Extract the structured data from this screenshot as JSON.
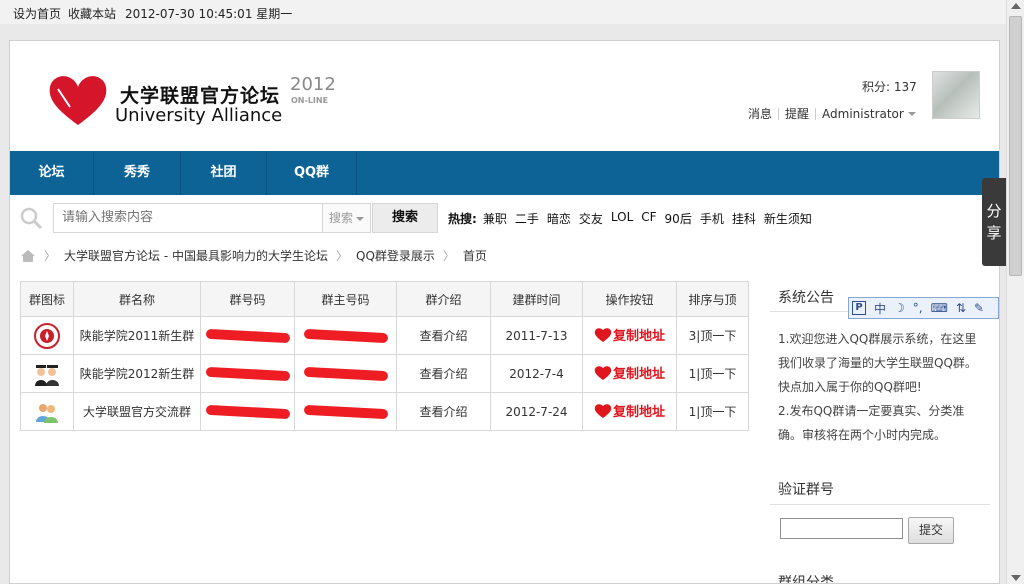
{
  "topbar": {
    "set_home": "设为首页",
    "bookmark": "收藏本站",
    "datetime": "2012-07-30 10:45:01 星期一"
  },
  "header": {
    "logo_cn": "大学联盟官方论坛",
    "logo_en": "University  Alliance",
    "logo_year": "2012",
    "logo_online": "ON-LINE",
    "score": "积分: 137",
    "messages": "消息",
    "reminders": "提醒",
    "username": "Administrator"
  },
  "nav": [
    "论坛",
    "秀秀",
    "社团",
    "QQ群"
  ],
  "search": {
    "placeholder": "请输入搜索内容",
    "scope": "搜索",
    "button": "搜索",
    "hot_label": "热搜:",
    "hot_keywords": [
      "兼职",
      "二手",
      "暗恋",
      "交友",
      "LOL",
      "CF",
      "90后",
      "手机",
      "挂科",
      "新生须知"
    ]
  },
  "breadcrumb": [
    "大学联盟官方论坛 - 中国最具影响力的大学生论坛",
    "QQ群登录展示",
    "首页"
  ],
  "table": {
    "headers": [
      "群图标",
      "群名称",
      "群号码",
      "群主号码",
      "群介绍",
      "建群时间",
      "操作按钮",
      "排序与顶"
    ],
    "rows": [
      {
        "icon": "university-badge-icon",
        "name": "陕能学院2011新生群",
        "intro": "查看介绍",
        "date": "2011-7-13",
        "copy": "复制地址",
        "rank": "3|顶一下"
      },
      {
        "icon": "graduates-icon",
        "name": "陕能学院2012新生群",
        "intro": "查看介绍",
        "date": "2012-7-4",
        "copy": "复制地址",
        "rank": "1|顶一下"
      },
      {
        "icon": "users-group-icon",
        "name": "大学联盟官方交流群",
        "intro": "查看介绍",
        "date": "2012-7-24",
        "copy": "复制地址",
        "rank": "1|顶一下"
      }
    ]
  },
  "sidebar": {
    "notice_title": "系统公告",
    "notice_1": "1.欢迎您进入QQ群展示系统，在这里我们收录了海量的大学生联盟QQ群。快点加入属于你的QQ群吧!",
    "notice_2": "2.发布QQ群请一定要真实、分类准确。审核将在两个小时内完成。",
    "verify_title": "验证群号",
    "verify_button": "提交",
    "category_title": "群组分类"
  },
  "ime": {
    "mode": "中"
  },
  "share": "分享",
  "colors": {
    "nav": "#0d6296",
    "accent_red": "#e0161f"
  }
}
